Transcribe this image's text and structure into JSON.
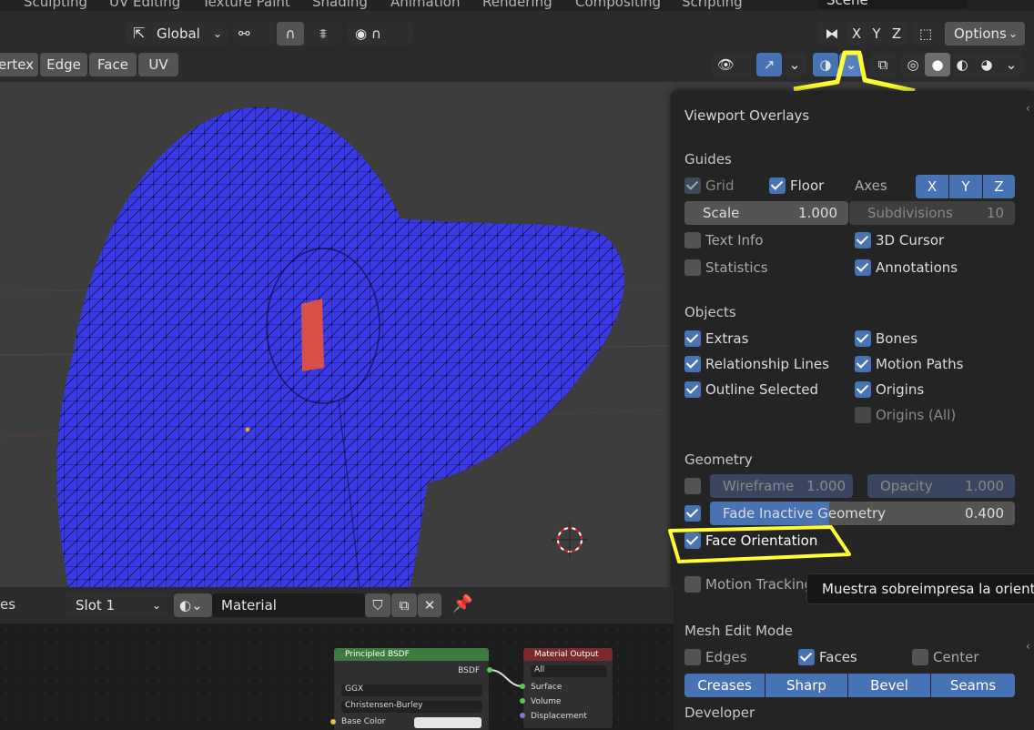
{
  "workspace_tabs": [
    "Sculpting",
    "UV Editing",
    "Texture Paint",
    "Shading",
    "Animation",
    "Rendering",
    "Compositing",
    "Scripting"
  ],
  "scene_name": "Scene",
  "header": {
    "transform_orientation": "Global",
    "axis_x": "X",
    "axis_y": "Y",
    "axis_z": "Z",
    "options_label": "Options",
    "select_modes": [
      "ertex",
      "Edge",
      "Face",
      "UV"
    ]
  },
  "overlays": {
    "title": "Viewport Overlays",
    "guides": {
      "heading": "Guides",
      "grid": "Grid",
      "floor": "Floor",
      "axes": "Axes",
      "axes_x": "X",
      "axes_y": "Y",
      "axes_z": "Z",
      "scale_label": "Scale",
      "scale_value": "1.000",
      "subdivisions_label": "Subdivisions",
      "subdivisions_value": "10",
      "text_info": "Text Info",
      "cursor_3d": "3D Cursor",
      "statistics": "Statistics",
      "annotations": "Annotations"
    },
    "objects": {
      "heading": "Objects",
      "extras": "Extras",
      "bones": "Bones",
      "relationship_lines": "Relationship Lines",
      "motion_paths": "Motion Paths",
      "outline_selected": "Outline Selected",
      "origins": "Origins",
      "origins_all": "Origins (All)"
    },
    "geometry": {
      "heading": "Geometry",
      "wireframe_label": "Wireframe",
      "wireframe_value": "1.000",
      "opacity_label": "Opacity",
      "opacity_value": "1.000",
      "fade_label": "Fade Inactive Geometry",
      "fade_value": "0.400",
      "face_orientation": "Face Orientation"
    },
    "motion_tracking": "Motion Tracking",
    "mesh_edit": {
      "heading": "Mesh Edit Mode",
      "edges": "Edges",
      "faces": "Faces",
      "center": "Center",
      "creases": "Creases",
      "sharp": "Sharp",
      "bevel": "Bevel",
      "seams": "Seams"
    },
    "developer": "Developer"
  },
  "tooltip": "Muestra sobreimpresa la orientación",
  "material_bar": {
    "left_label": "es",
    "slot": "Slot 1",
    "material_name": "Material"
  },
  "nodes": {
    "bsdf": {
      "title": "Principled BSDF",
      "output": "BSDF",
      "distribution": "GGX",
      "subsurface": "Christensen-Burley",
      "base_color": "Base Color"
    },
    "output": {
      "title": "Material Output",
      "target": "All",
      "surface": "Surface",
      "volume": "Volume",
      "displacement": "Displacement"
    }
  },
  "colors": {
    "accent": "#4772b3",
    "mesh": "#3a3ae8",
    "backface": "#d9504a",
    "highlight": "#ffff33"
  }
}
